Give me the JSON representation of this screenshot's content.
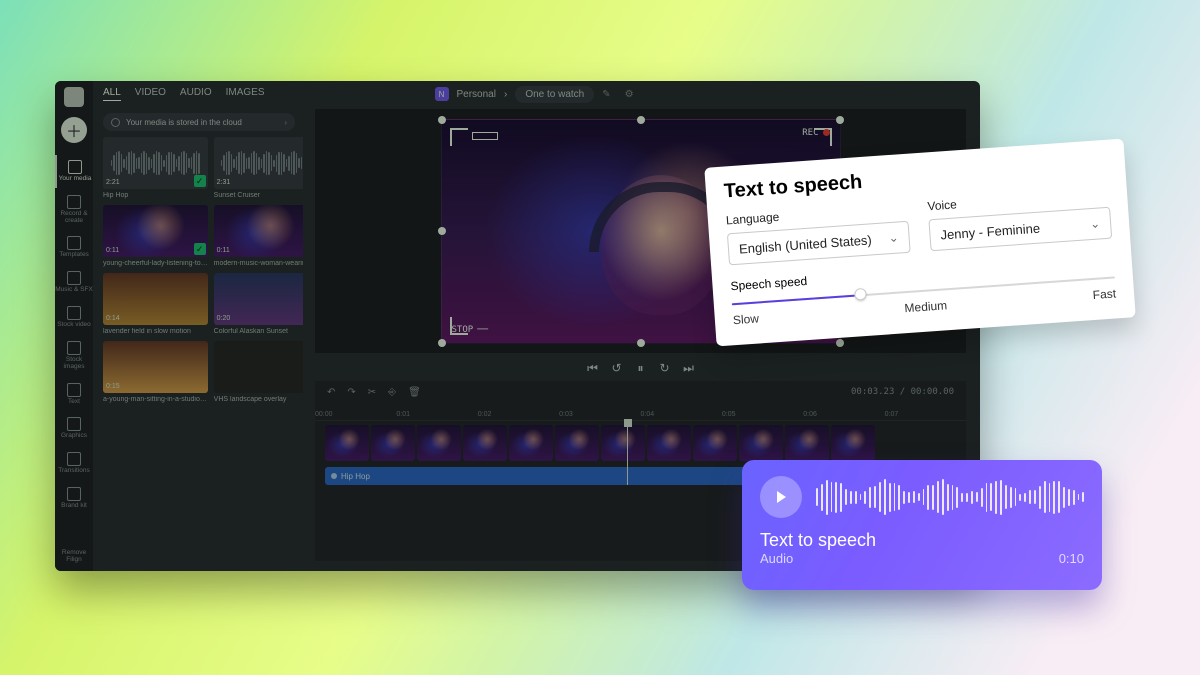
{
  "sidebar": {
    "items": [
      {
        "label": "Your media"
      },
      {
        "label": "Record & create"
      },
      {
        "label": "Templates"
      },
      {
        "label": "Music & SFX"
      },
      {
        "label": "Stock video"
      },
      {
        "label": "Stock images"
      },
      {
        "label": "Text"
      },
      {
        "label": "Graphics"
      },
      {
        "label": "Transitions"
      },
      {
        "label": "Brand kit"
      }
    ],
    "bottom": "Remove Filign"
  },
  "header": {
    "tabs": [
      "ALL",
      "VIDEO",
      "AUDIO",
      "IMAGES"
    ],
    "active_tab": 0,
    "crumb_badge": "N",
    "crumb_workspace": "Personal",
    "crumb_project": "One to watch"
  },
  "notice": "Your media is stored in the cloud",
  "media": [
    {
      "dur": "2:21",
      "caption": "Hip Hop",
      "kind": "audio",
      "checked": true
    },
    {
      "dur": "2:31",
      "caption": "Sunset Cruiser",
      "kind": "audio",
      "checked": true
    },
    {
      "dur": "0:11",
      "caption": "young-cheerful-lady-listening-to…",
      "kind": "video",
      "checked": true
    },
    {
      "dur": "0:11",
      "caption": "modern-music-woman-wearing…",
      "kind": "video",
      "checked": true
    },
    {
      "dur": "0:14",
      "caption": "lavender field in slow motion",
      "kind": "video",
      "checked": false
    },
    {
      "dur": "0:20",
      "caption": "Colorful Alaskan Sunset",
      "kind": "video",
      "checked": false
    },
    {
      "dur": "0:15",
      "caption": "a-young-man-sitting-in-a-studio…",
      "kind": "video",
      "checked": false
    },
    {
      "dur": "",
      "caption": "VHS landscape overlay",
      "kind": "video",
      "checked": false
    }
  ],
  "preview": {
    "rec": "REC",
    "stop": "STOP"
  },
  "timeline": {
    "time_current": "00:03.23",
    "time_total": "00:00.00",
    "ticks": [
      "00:00",
      "0:01",
      "0:02",
      "0:03",
      "0:04",
      "0:05",
      "0:06",
      "0:07"
    ],
    "clip_count": 12,
    "audio_label": "Hip Hop"
  },
  "tts": {
    "title": "Text to speech",
    "language_label": "Language",
    "language_value": "English (United States)",
    "voice_label": "Voice",
    "voice_value": "Jenny - Feminine",
    "speed_label": "Speech speed",
    "speed_ticks": [
      "Slow",
      "Medium",
      "Fast"
    ]
  },
  "audio": {
    "title": "Text to speech",
    "subtitle": "Audio",
    "duration": "0:10"
  }
}
